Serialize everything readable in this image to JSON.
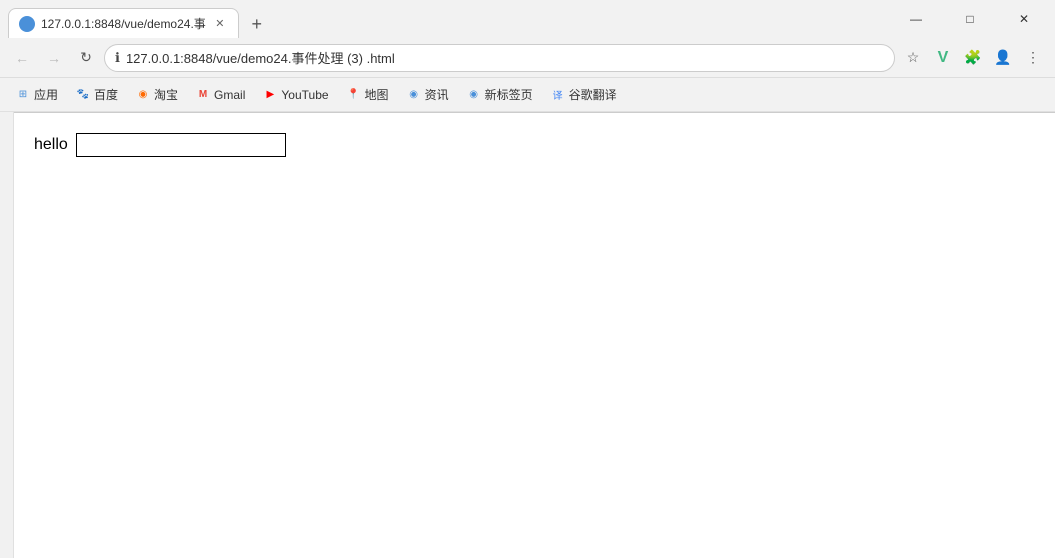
{
  "window": {
    "title": "127.0.0.1:8848/vue/demo24.事件处理 (3) .html",
    "tab_title": "127.0.0.1:8848/vue/demo24.事",
    "url": "127.0.0.1:8848/vue/demo24.事件处理 (3) .html"
  },
  "window_controls": {
    "minimize": "—",
    "maximize": "□",
    "close": "✕"
  },
  "nav": {
    "back": "←",
    "forward": "→",
    "refresh": "↻"
  },
  "bookmarks": [
    {
      "id": "apps",
      "label": "应用",
      "icon": "⊞",
      "color": "favicon-apps"
    },
    {
      "id": "baidu",
      "label": "百度",
      "icon": "🐾",
      "color": "favicon-baidu"
    },
    {
      "id": "taobao",
      "label": "淘宝",
      "icon": "◉",
      "color": "favicon-taobao"
    },
    {
      "id": "gmail",
      "label": "Gmail",
      "icon": "M",
      "color": "favicon-gmail"
    },
    {
      "id": "youtube",
      "label": "YouTube",
      "icon": "▶",
      "color": "favicon-youtube"
    },
    {
      "id": "maps",
      "label": "地图",
      "icon": "📍",
      "color": "favicon-maps"
    },
    {
      "id": "news",
      "label": "资讯",
      "icon": "◉",
      "color": "favicon-news"
    },
    {
      "id": "newtab",
      "label": "新标签页",
      "icon": "◉",
      "color": "favicon-newtab"
    },
    {
      "id": "translate",
      "label": "谷歌翻译",
      "icon": "译",
      "color": "favicon-translate"
    }
  ],
  "toolbar_icons": {
    "bookmark_star": "☆",
    "vue": "V",
    "extensions": "🧩",
    "profile": "👤",
    "menu": "⋮"
  },
  "page": {
    "hello_label": "hello",
    "input_value": "",
    "input_placeholder": ""
  }
}
